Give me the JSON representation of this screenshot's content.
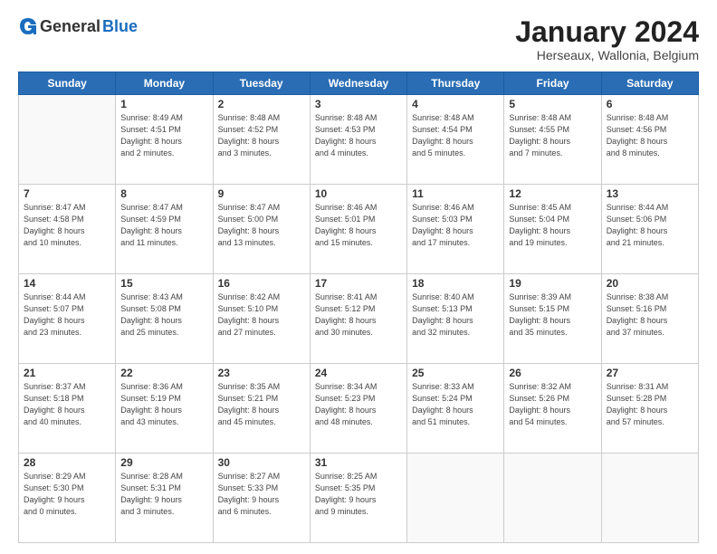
{
  "logo": {
    "general": "General",
    "blue": "Blue"
  },
  "header": {
    "month": "January 2024",
    "location": "Herseaux, Wallonia, Belgium"
  },
  "days": [
    "Sunday",
    "Monday",
    "Tuesday",
    "Wednesday",
    "Thursday",
    "Friday",
    "Saturday"
  ],
  "weeks": [
    [
      {
        "day": "",
        "info": ""
      },
      {
        "day": "1",
        "info": "Sunrise: 8:49 AM\nSunset: 4:51 PM\nDaylight: 8 hours\nand 2 minutes."
      },
      {
        "day": "2",
        "info": "Sunrise: 8:48 AM\nSunset: 4:52 PM\nDaylight: 8 hours\nand 3 minutes."
      },
      {
        "day": "3",
        "info": "Sunrise: 8:48 AM\nSunset: 4:53 PM\nDaylight: 8 hours\nand 4 minutes."
      },
      {
        "day": "4",
        "info": "Sunrise: 8:48 AM\nSunset: 4:54 PM\nDaylight: 8 hours\nand 5 minutes."
      },
      {
        "day": "5",
        "info": "Sunrise: 8:48 AM\nSunset: 4:55 PM\nDaylight: 8 hours\nand 7 minutes."
      },
      {
        "day": "6",
        "info": "Sunrise: 8:48 AM\nSunset: 4:56 PM\nDaylight: 8 hours\nand 8 minutes."
      }
    ],
    [
      {
        "day": "7",
        "info": "Sunrise: 8:47 AM\nSunset: 4:58 PM\nDaylight: 8 hours\nand 10 minutes."
      },
      {
        "day": "8",
        "info": "Sunrise: 8:47 AM\nSunset: 4:59 PM\nDaylight: 8 hours\nand 11 minutes."
      },
      {
        "day": "9",
        "info": "Sunrise: 8:47 AM\nSunset: 5:00 PM\nDaylight: 8 hours\nand 13 minutes."
      },
      {
        "day": "10",
        "info": "Sunrise: 8:46 AM\nSunset: 5:01 PM\nDaylight: 8 hours\nand 15 minutes."
      },
      {
        "day": "11",
        "info": "Sunrise: 8:46 AM\nSunset: 5:03 PM\nDaylight: 8 hours\nand 17 minutes."
      },
      {
        "day": "12",
        "info": "Sunrise: 8:45 AM\nSunset: 5:04 PM\nDaylight: 8 hours\nand 19 minutes."
      },
      {
        "day": "13",
        "info": "Sunrise: 8:44 AM\nSunset: 5:06 PM\nDaylight: 8 hours\nand 21 minutes."
      }
    ],
    [
      {
        "day": "14",
        "info": "Sunrise: 8:44 AM\nSunset: 5:07 PM\nDaylight: 8 hours\nand 23 minutes."
      },
      {
        "day": "15",
        "info": "Sunrise: 8:43 AM\nSunset: 5:08 PM\nDaylight: 8 hours\nand 25 minutes."
      },
      {
        "day": "16",
        "info": "Sunrise: 8:42 AM\nSunset: 5:10 PM\nDaylight: 8 hours\nand 27 minutes."
      },
      {
        "day": "17",
        "info": "Sunrise: 8:41 AM\nSunset: 5:12 PM\nDaylight: 8 hours\nand 30 minutes."
      },
      {
        "day": "18",
        "info": "Sunrise: 8:40 AM\nSunset: 5:13 PM\nDaylight: 8 hours\nand 32 minutes."
      },
      {
        "day": "19",
        "info": "Sunrise: 8:39 AM\nSunset: 5:15 PM\nDaylight: 8 hours\nand 35 minutes."
      },
      {
        "day": "20",
        "info": "Sunrise: 8:38 AM\nSunset: 5:16 PM\nDaylight: 8 hours\nand 37 minutes."
      }
    ],
    [
      {
        "day": "21",
        "info": "Sunrise: 8:37 AM\nSunset: 5:18 PM\nDaylight: 8 hours\nand 40 minutes."
      },
      {
        "day": "22",
        "info": "Sunrise: 8:36 AM\nSunset: 5:19 PM\nDaylight: 8 hours\nand 43 minutes."
      },
      {
        "day": "23",
        "info": "Sunrise: 8:35 AM\nSunset: 5:21 PM\nDaylight: 8 hours\nand 45 minutes."
      },
      {
        "day": "24",
        "info": "Sunrise: 8:34 AM\nSunset: 5:23 PM\nDaylight: 8 hours\nand 48 minutes."
      },
      {
        "day": "25",
        "info": "Sunrise: 8:33 AM\nSunset: 5:24 PM\nDaylight: 8 hours\nand 51 minutes."
      },
      {
        "day": "26",
        "info": "Sunrise: 8:32 AM\nSunset: 5:26 PM\nDaylight: 8 hours\nand 54 minutes."
      },
      {
        "day": "27",
        "info": "Sunrise: 8:31 AM\nSunset: 5:28 PM\nDaylight: 8 hours\nand 57 minutes."
      }
    ],
    [
      {
        "day": "28",
        "info": "Sunrise: 8:29 AM\nSunset: 5:30 PM\nDaylight: 9 hours\nand 0 minutes."
      },
      {
        "day": "29",
        "info": "Sunrise: 8:28 AM\nSunset: 5:31 PM\nDaylight: 9 hours\nand 3 minutes."
      },
      {
        "day": "30",
        "info": "Sunrise: 8:27 AM\nSunset: 5:33 PM\nDaylight: 9 hours\nand 6 minutes."
      },
      {
        "day": "31",
        "info": "Sunrise: 8:25 AM\nSunset: 5:35 PM\nDaylight: 9 hours\nand 9 minutes."
      },
      {
        "day": "",
        "info": ""
      },
      {
        "day": "",
        "info": ""
      },
      {
        "day": "",
        "info": ""
      }
    ]
  ]
}
